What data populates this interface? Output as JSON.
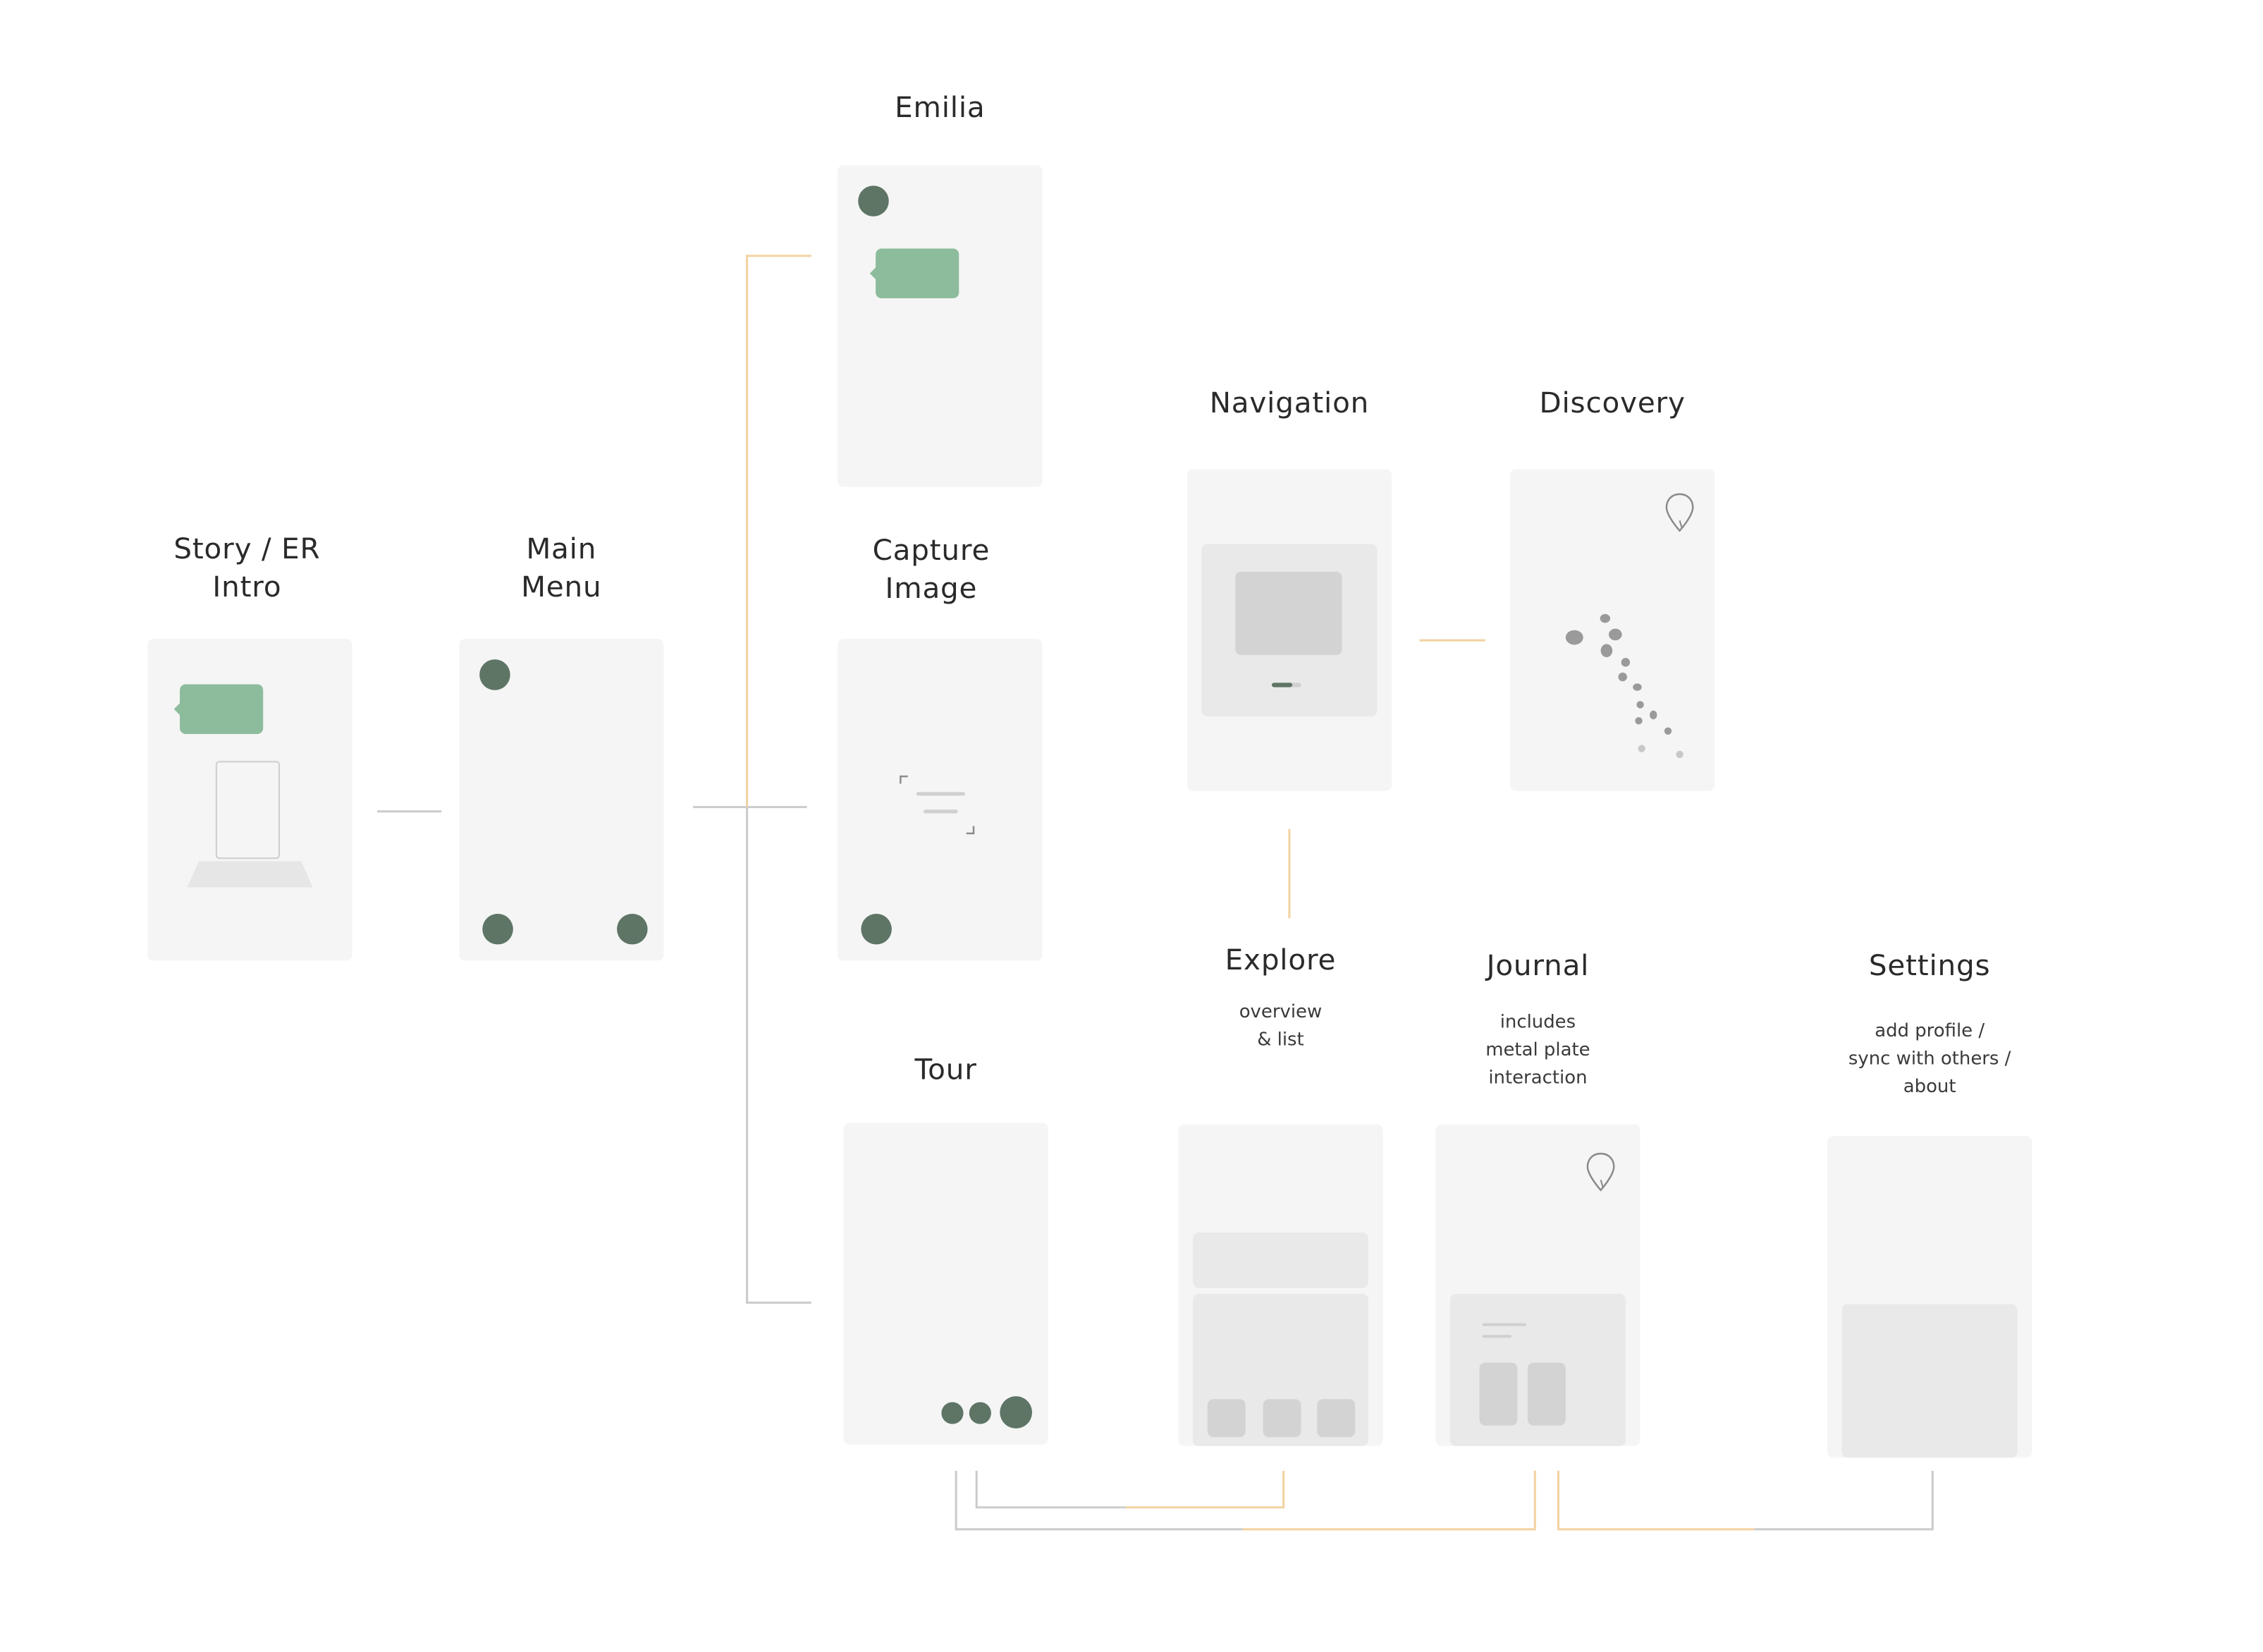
{
  "diagram": {
    "nodes": {
      "story": {
        "title_line1": "Story / ER",
        "title_line2": "Intro"
      },
      "main_menu": {
        "title_line1": "Main",
        "title_line2": "Menu"
      },
      "emilia": {
        "title": "Emilia"
      },
      "capture": {
        "title_line1": "Capture",
        "title_line2": "Image"
      },
      "tour": {
        "title": "Tour"
      },
      "navigation": {
        "title": "Navigation"
      },
      "discovery": {
        "title": "Discovery"
      },
      "explore": {
        "title": "Explore",
        "sub_line1": "overview",
        "sub_line2": "& list"
      },
      "journal": {
        "title": "Journal",
        "sub_line1": "includes",
        "sub_line2": "metal plate",
        "sub_line3": "interaction"
      },
      "settings": {
        "title": "Settings",
        "sub_line1": "add profile /",
        "sub_line2": "sync with others /",
        "sub_line3": "about"
      }
    },
    "edges": [
      {
        "from": "story",
        "to": "main_menu",
        "color": "gray"
      },
      {
        "from": "main_menu",
        "to": "emilia",
        "color": "orange"
      },
      {
        "from": "main_menu",
        "to": "capture",
        "color": "gray"
      },
      {
        "from": "main_menu",
        "to": "tour",
        "color": "gray"
      },
      {
        "from": "navigation",
        "to": "discovery",
        "color": "orange"
      },
      {
        "from": "navigation",
        "to": "explore",
        "color": "orange"
      },
      {
        "from": "tour",
        "to": "explore",
        "color": "mixed"
      },
      {
        "from": "tour",
        "to": "journal",
        "color": "mixed"
      },
      {
        "from": "journal",
        "to": "settings",
        "color": "mixed"
      }
    ],
    "colors": {
      "screen": "#f5f5f5",
      "dot": "#5e7566",
      "bubble": "#8cbc9c",
      "line_gray": "#cccccc",
      "line_orange": "#f2d3a2",
      "placeholder": "#e9e9e9",
      "placeholder_dark": "#d3d3d3"
    }
  }
}
